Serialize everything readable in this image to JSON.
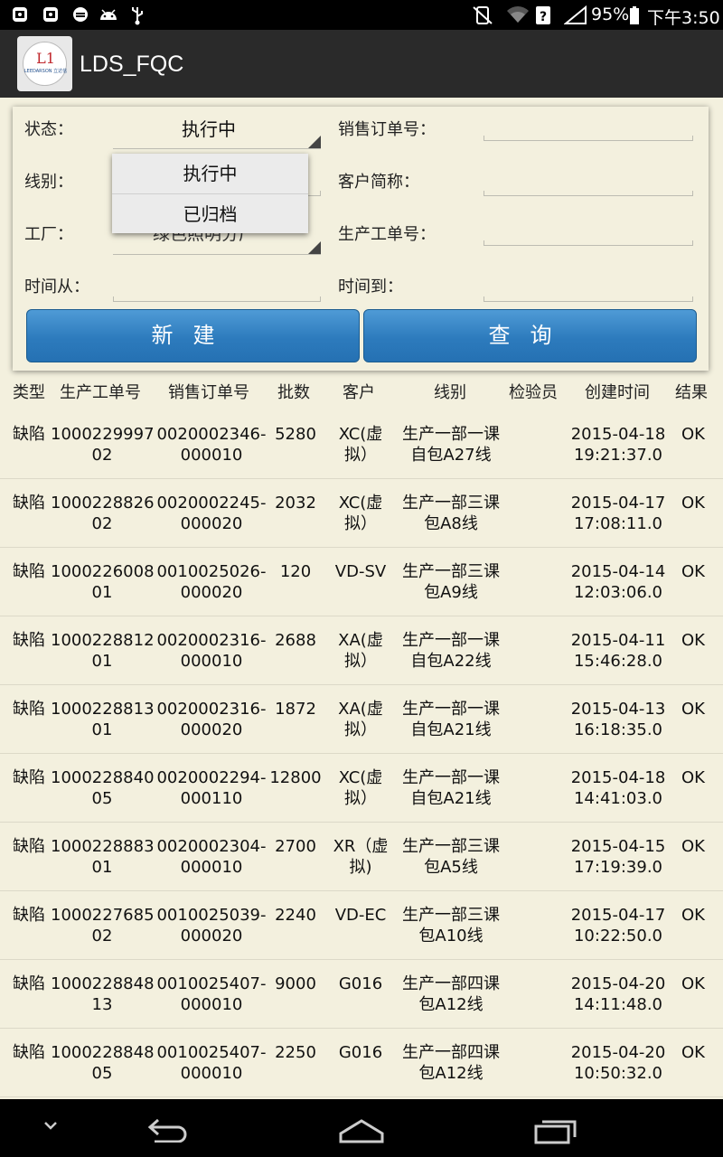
{
  "status_bar": {
    "battery": "95%",
    "time": "下午3:50",
    "icons": [
      "photo-icon",
      "photo-icon",
      "sync-icon",
      "android-icon",
      "usb-icon",
      "no-sim-icon",
      "wifi-icon",
      "question-icon",
      "signal-icon",
      "battery-icon"
    ]
  },
  "app_bar": {
    "title": "LDS_FQC",
    "logo_text": "L1",
    "logo_subtext": "LEEDARSON 立达信"
  },
  "filters": {
    "status_label": "状态：",
    "status_value": "执行中",
    "line_label": "线别：",
    "factory_label": "工厂：",
    "factory_value": "绿色照明分厂",
    "time_from_label": "时间从：",
    "sales_order_label": "销售订单号：",
    "customer_label": "客户简称：",
    "work_order_label": "生产工单号：",
    "time_to_label": "时间到：",
    "new_button": "新建",
    "query_button": "查询"
  },
  "dropdown": {
    "options": [
      "执行中",
      "已归档"
    ]
  },
  "table": {
    "headers": [
      "类型",
      "生产工单号",
      "销售订单号",
      "批数",
      "客户",
      "线别",
      "检验员",
      "创建时间",
      "结果"
    ],
    "rows": [
      {
        "type": "缺陷",
        "work1": "1000229997",
        "work2": "02",
        "sales1": "0020002346-",
        "sales2": "000010",
        "qty": "5280",
        "cust1": "XC(虚",
        "cust2": "拟）",
        "line1": "生产一部一课",
        "line2": "自包A27线",
        "inspector": "",
        "date": "2015-04-18",
        "time": "19:21:37.0",
        "result": "OK"
      },
      {
        "type": "缺陷",
        "work1": "1000228826",
        "work2": "02",
        "sales1": "0020002245-",
        "sales2": "000020",
        "qty": "2032",
        "cust1": "XC(虚",
        "cust2": "拟）",
        "line1": "生产一部三课",
        "line2": "包A8线",
        "inspector": "",
        "date": "2015-04-17",
        "time": "17:08:11.0",
        "result": "OK"
      },
      {
        "type": "缺陷",
        "work1": "1000226008",
        "work2": "01",
        "sales1": "0010025026-",
        "sales2": "000020",
        "qty": "120",
        "cust1": "VD-SV",
        "cust2": "",
        "line1": "生产一部三课",
        "line2": "包A9线",
        "inspector": "",
        "date": "2015-04-14",
        "time": "12:03:06.0",
        "result": "OK"
      },
      {
        "type": "缺陷",
        "work1": "1000228812",
        "work2": "01",
        "sales1": "0020002316-",
        "sales2": "000010",
        "qty": "2688",
        "cust1": "XA(虚",
        "cust2": "拟）",
        "line1": "生产一部一课",
        "line2": "自包A22线",
        "inspector": "",
        "date": "2015-04-11",
        "time": "15:46:28.0",
        "result": "OK"
      },
      {
        "type": "缺陷",
        "work1": "1000228813",
        "work2": "01",
        "sales1": "0020002316-",
        "sales2": "000020",
        "qty": "1872",
        "cust1": "XA(虚",
        "cust2": "拟）",
        "line1": "生产一部一课",
        "line2": "自包A21线",
        "inspector": "",
        "date": "2015-04-13",
        "time": "16:18:35.0",
        "result": "OK"
      },
      {
        "type": "缺陷",
        "work1": "1000228840",
        "work2": "05",
        "sales1": "0020002294-",
        "sales2": "000110",
        "qty": "12800",
        "cust1": "XC(虚",
        "cust2": "拟）",
        "line1": "生产一部一课",
        "line2": "自包A21线",
        "inspector": "",
        "date": "2015-04-18",
        "time": "14:41:03.0",
        "result": "OK"
      },
      {
        "type": "缺陷",
        "work1": "1000228883",
        "work2": "01",
        "sales1": "0020002304-",
        "sales2": "000010",
        "qty": "2700",
        "cust1": "XR（虚",
        "cust2": "拟)",
        "line1": "生产一部三课",
        "line2": "包A5线",
        "inspector": "",
        "date": "2015-04-15",
        "time": "17:19:39.0",
        "result": "OK"
      },
      {
        "type": "缺陷",
        "work1": "1000227685",
        "work2": "02",
        "sales1": "0010025039-",
        "sales2": "000020",
        "qty": "2240",
        "cust1": "VD-EC",
        "cust2": "",
        "line1": "生产一部三课",
        "line2": "包A10线",
        "inspector": "",
        "date": "2015-04-17",
        "time": "10:22:50.0",
        "result": "OK"
      },
      {
        "type": "缺陷",
        "work1": "1000228848",
        "work2": "13",
        "sales1": "0010025407-",
        "sales2": "000010",
        "qty": "9000",
        "cust1": "G016",
        "cust2": "",
        "line1": "生产一部四课",
        "line2": "包A12线",
        "inspector": "",
        "date": "2015-04-20",
        "time": "14:11:48.0",
        "result": "OK"
      },
      {
        "type": "缺陷",
        "work1": "1000228848",
        "work2": "05",
        "sales1": "0010025407-",
        "sales2": "000010",
        "qty": "2250",
        "cust1": "G016",
        "cust2": "",
        "line1": "生产一部四课",
        "line2": "包A12线",
        "inspector": "",
        "date": "2015-04-20",
        "time": "10:50:32.0",
        "result": "OK"
      }
    ]
  },
  "nav_bar": {
    "icons": [
      "hide-keyboard-icon",
      "back-icon",
      "home-icon",
      "recent-apps-icon"
    ]
  },
  "colors": {
    "background": "#f3f0de",
    "action_bar": "#2a2a2a",
    "button": "#2d7bbd"
  }
}
